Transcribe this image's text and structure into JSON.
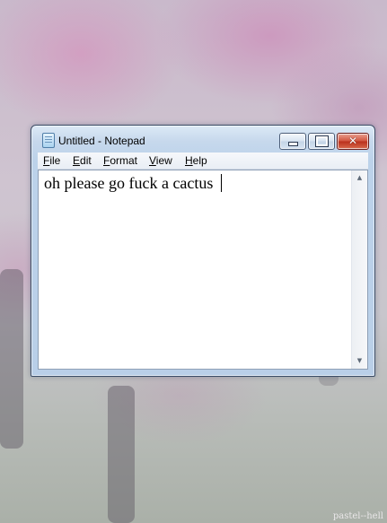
{
  "window": {
    "title": "Untitled - Notepad",
    "controls": {
      "minimize_icon": "minimize-icon",
      "maximize_icon": "maximize-icon",
      "close_label": "✕"
    }
  },
  "menu": {
    "items": [
      {
        "label": "File"
      },
      {
        "label": "Edit"
      },
      {
        "label": "Format"
      },
      {
        "label": "View"
      },
      {
        "label": "Help"
      }
    ]
  },
  "editor": {
    "content": "oh please go fuck a cactus "
  },
  "scrollbar": {
    "up_icon": "▲",
    "down_icon": "▼"
  },
  "watermark": "pastel--hell",
  "colors": {
    "close_button": "#c9442f",
    "window_frame": "#bcd2ea"
  }
}
